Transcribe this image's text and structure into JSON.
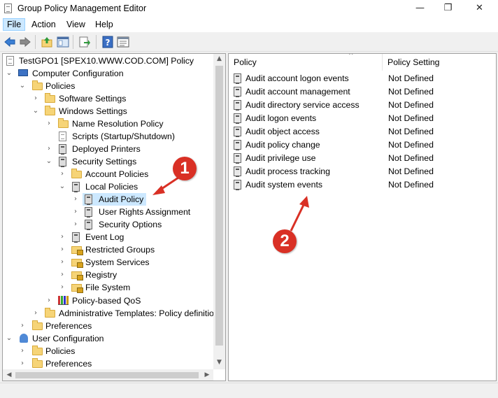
{
  "window": {
    "title": "Group Policy Management Editor",
    "minimize": "—",
    "restore": "❐",
    "close": "✕"
  },
  "menu": [
    "File",
    "Action",
    "View",
    "Help"
  ],
  "toolbar": {
    "buttons": [
      "back-arrow-icon",
      "forward-arrow-icon",
      "up-folder-icon",
      "show-hide-tree-icon",
      "export-list-icon",
      "help-icon",
      "properties-icon"
    ]
  },
  "tree": {
    "root": "TestGPO1 [SPEX10.WWW.COD.COM] Policy",
    "computer_configuration": "Computer Configuration",
    "policies": "Policies",
    "software_settings": "Software Settings",
    "windows_settings": "Windows Settings",
    "name_resolution_policy": "Name Resolution Policy",
    "scripts": "Scripts (Startup/Shutdown)",
    "deployed_printers": "Deployed Printers",
    "security_settings": "Security Settings",
    "account_policies": "Account Policies",
    "local_policies": "Local Policies",
    "audit_policy": "Audit Policy",
    "user_rights_assignment": "User Rights Assignment",
    "security_options": "Security Options",
    "event_log": "Event Log",
    "restricted_groups": "Restricted Groups",
    "system_services": "System Services",
    "registry": "Registry",
    "file_system": "File System",
    "policy_based_qos": "Policy-based QoS",
    "administrative_templates": "Administrative Templates: Policy definitio",
    "preferences": "Preferences",
    "user_configuration": "User Configuration",
    "user_policies": "Policies",
    "user_preferences": "Preferences"
  },
  "list": {
    "col_policy": "Policy",
    "col_setting": "Policy Setting",
    "rows": [
      {
        "policy": "Audit account logon events",
        "setting": "Not Defined"
      },
      {
        "policy": "Audit account management",
        "setting": "Not Defined"
      },
      {
        "policy": "Audit directory service access",
        "setting": "Not Defined"
      },
      {
        "policy": "Audit logon events",
        "setting": "Not Defined"
      },
      {
        "policy": "Audit object access",
        "setting": "Not Defined"
      },
      {
        "policy": "Audit policy change",
        "setting": "Not Defined"
      },
      {
        "policy": "Audit privilege use",
        "setting": "Not Defined"
      },
      {
        "policy": "Audit process tracking",
        "setting": "Not Defined"
      },
      {
        "policy": "Audit system events",
        "setting": "Not Defined"
      }
    ]
  },
  "annotations": {
    "badge1": "1",
    "badge2": "2",
    "color": "#d93025"
  }
}
